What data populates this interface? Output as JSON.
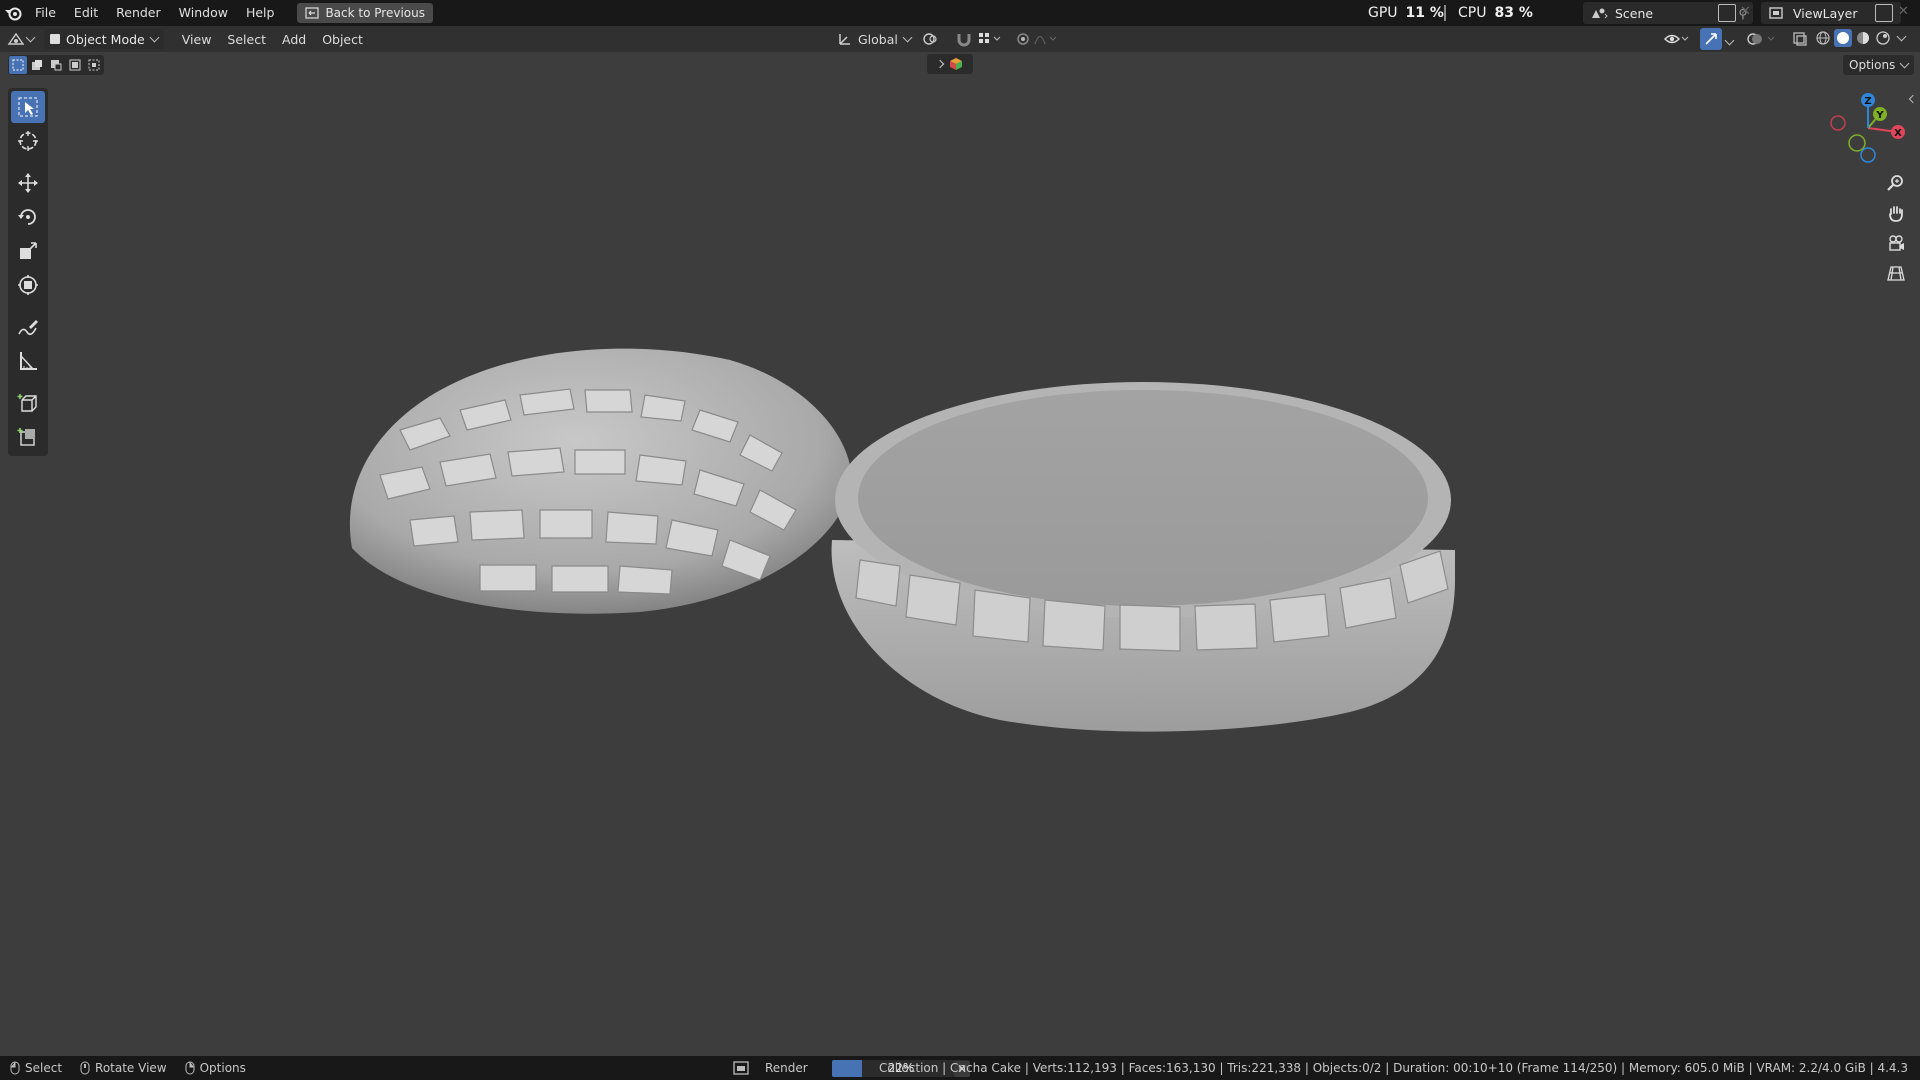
{
  "menu": [
    "File",
    "Edit",
    "Render",
    "Window",
    "Help"
  ],
  "back_button": "Back to Previous",
  "perf": {
    "gpu_label": "GPU",
    "gpu_value": "11 %",
    "cpu_label": "CPU",
    "cpu_value": "83 %"
  },
  "scene": "Scene",
  "view_layer": "ViewLayer",
  "header": {
    "mode": "Object Mode",
    "menus": [
      "View",
      "Select",
      "Add",
      "Object"
    ],
    "orientation": "Global",
    "options": "Options"
  },
  "gizmo": {
    "x": "X",
    "y": "Y",
    "z": "Z"
  },
  "status": {
    "select": "Select",
    "rotate": "Rotate View",
    "options": "Options",
    "render_label": "Render",
    "progress_text": "22%",
    "progress": 0.22,
    "info": "Collection | Cncha Cake | Verts:112,193 | Faces:163,130 | Tris:221,338 | Objects:0/2 | Duration: 00:10+10 (Frame 114/250) | Memory: 605.0 MiB | VRAM: 2.2/4.0 GiB | 4.4.3"
  },
  "colors": {
    "accent": "#4772b3",
    "x_axis": "#e0465a",
    "y_axis": "#7fb025",
    "z_axis": "#2f86d9"
  }
}
